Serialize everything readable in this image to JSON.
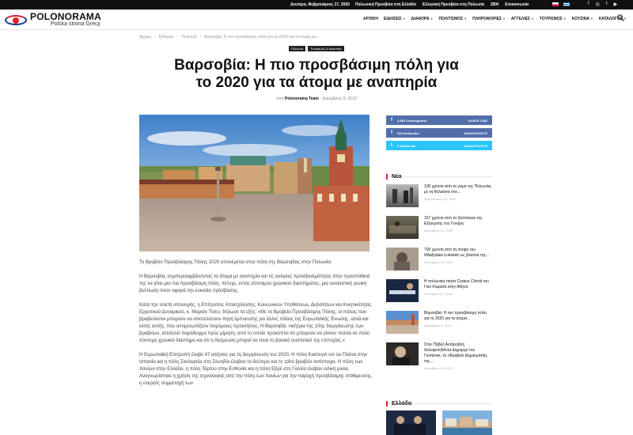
{
  "topbar": {
    "date": "Δευτέρα, Φεβρουάριος 17, 2020",
    "links": [
      "Πολωνική Πρεσβεία στη Ελλάδα",
      "Ελληνική Πρεσβεία στη Πολωνία",
      "ZBH",
      "Επικοινωνία"
    ],
    "flags": [
      "pl-flag",
      "gr-flag"
    ],
    "social": [
      "facebook-icon",
      "instagram-icon",
      "twitter-icon",
      "youtube-icon"
    ]
  },
  "header": {
    "brand": "POLONORAMA",
    "tagline": "Polska strona Grecji",
    "nav": [
      {
        "label": "ΑΡΧΙΚΗ",
        "dropdown": false
      },
      {
        "label": "ΕΙΔΗΣΕΙΣ",
        "dropdown": true
      },
      {
        "label": "ΔΙΑΦΟΡΑ",
        "dropdown": true
      },
      {
        "label": "ΠΟΛΙΤΙΣΜΟΣ",
        "dropdown": true
      },
      {
        "label": "ΠΛΗΡΟΦΟΡΙΕΣ",
        "dropdown": true
      },
      {
        "label": "ΑΓΓΕΛΙΕΣ",
        "dropdown": true
      },
      {
        "label": "ΤΟΥΡΙΣΜΟΣ",
        "dropdown": true
      },
      {
        "label": "ΚΟΥΖΙΝΑ",
        "dropdown": true
      },
      {
        "label": "ΚΑΤΑΛΟΓΟΣ",
        "dropdown": true
      }
    ],
    "search_icon": "search-icon"
  },
  "breadcrumb": [
    "Αρχική",
    "Ειδήσεις",
    "Πολωνία",
    "Βαρσοβία: Η πιο προσβάσιμη πόλη για το 2020 για τα άτομα με..."
  ],
  "breadcrumb_sep": "›",
  "article": {
    "tags": [
      "Πολωνία",
      "Τουρισμός & Διακοπές"
    ],
    "title": "Βαρσοβία: Η πιο προσβάσιμη πόλη για το 2020 για τα άτομα με αναπηρία",
    "by_prefix": "από",
    "author": "Polonorama Team",
    "dash": "-",
    "date": "Δεκέμβριος 8, 2019",
    "paragraphs": [
      "Το Βραβείο Προσβάσιμης Πόλης 2020 απονέμεται στην πόλη της Βαρσοβίας στην Πολωνία.",
      "Η Βαρσοβία, συμπεριλαμβάνοντας τα άτομα με αναπηρία και τις ανάγκες προσβασιμότητας στην προσπάθειά της να γίνει μια πιο προσβάσιμη πόλη, πέτυχε, εντός σύντομου χρονικού διαστήματος, μια ουσιαστική γενική βελτίωση όσον αφορά την ευκολία πρόσβασης.",
      "Κατά την τελετή απονομής, η Επίτροπος Απασχόλησης, Κοινωνικών Υποθέσεων, Δεξιοτήτων και Κινητικότητας Εργατικού Δυναμικού, κ. Μαριάν Τίσεν, δήλωσε τα εξής: «Με το Βραβείο Προσβάσιμης Πόλης, οι πόλεις που βραβεύονται μπορούν να αποτελέσουν πηγή έμπνευσης για άλλες πόλεις της Ευρωπαϊκής Ένωσης, αλλά και εκτός αυτής, που αντιμετωπίζουν παρόμοιες προκλήσεις. Η Βαρσοβία, νικήτρια της 10ης διοργάνωσης των βραβείων, αποτελεί παράδειγμα προς μίμηση, από το οποίο προκύπτει ότι μπορούν να γίνουν πολλά σε πολύ σύντομο χρονικό διάστημα και ότι η δέσμευση μπορεί να είναι το βασικό συστατικό της επιτυχίας.»",
      "Η Ευρωπαϊκή Επιτροπή έλαβε 47 αιτήσεις για τη διοργάνωση του 2020. Η πόλη Καστεγιό ντε λα Πλάνα στην Ισπανία και η πόλη Σκελεφτέα στη Σουηδία έλαβαν το δεύτερο και το τρίτο βραβείο αντίστοιχα. Η πόλη των Χανίων στην Ελλάδα, η πόλη Τάρτου στην Εσθονία και η πόλη Εβρέ στη Γαλλία έλαβαν ειδική μνεία. Αναγνωρίστηκε η χρήση της τεχνολογίας από την πόλη των Χανίων για την παροχή προσβάσιμης στάθμευσης, η ενεργός συμμετοχή των"
    ]
  },
  "sidebar": {
    "social": [
      {
        "icon": "facebook-icon",
        "count": "4,984",
        "label": "Υποστηρικτές",
        "action": "ΚΑΝΤΕ LIKE",
        "color": "#516eab"
      },
      {
        "icon": "facebook-icon",
        "count": "520",
        "label": "Ακόλουθοι",
        "action": "ΑΚΟΛΟΥΘΗΣΤΕ",
        "color": "#516eab"
      },
      {
        "icon": "twitter-icon",
        "count": "4",
        "label": "Ακόλουθοι",
        "action": "ΑΚΟΛΟΥΘΗΣΤΕ",
        "color": "#29c5f6"
      }
    ],
    "news_heading": "Νέα",
    "news": [
      {
        "title": "100 χρόνια από το γάμο της Πολωνίας με τη θάλασσα στο...",
        "date": "Φεβρουάριος 10, 2020"
      },
      {
        "title": "157 χρόνια από το ξέσπασμα της Εξέγερσης του Γενάρη",
        "date": "Ιανουάριος 21, 2020"
      },
      {
        "title": "700 χρόνια από τη στέψη του Władysław Łokietek ως βασιλιά της...",
        "date": "Ιανουάριος 19, 2020"
      },
      {
        "title": "Η πολωνική ταινία Corpus Christi του Γιαν Κομασά στην Αθήνα",
        "date": "Ιανουάριος 11, 2020"
      },
      {
        "title": "Βαρσοβία: Η πιο προσβάσιμη πόλη για το 2020 για τα άτομα...",
        "date": "Δεκέμβριος 8, 2019"
      },
      {
        "title": "Στον Πάβελ Αντάμοβιτς, δολοφονηθέντα Δήμαρχο του Γκντανσκ, το «Βραβείο Δημοκρατίας της...",
        "date": "Οκτώβριος 13, 2019"
      }
    ],
    "greece_heading": "Ελλάδα"
  }
}
